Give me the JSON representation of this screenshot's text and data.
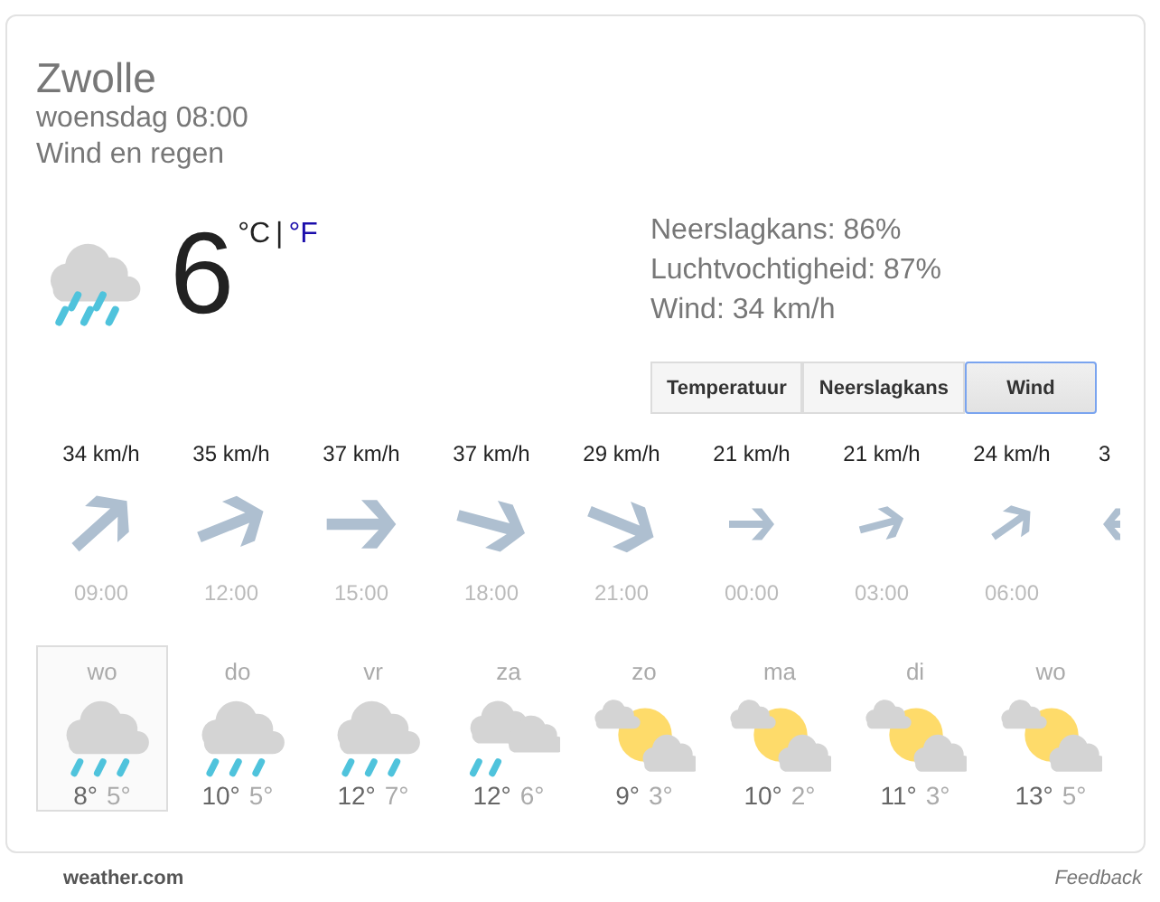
{
  "location": "Zwolle",
  "datetime": "woensdag 08:00",
  "condition": "Wind en regen",
  "current": {
    "kind": "rain",
    "temperature": "6",
    "unit_c": "°C",
    "unit_separator": "|",
    "unit_f": "°F",
    "unit_c_selected": true
  },
  "details": [
    "Neerslagkans: 86%",
    "Luchtvochtigheid: 87%",
    "Wind: 34 km/h"
  ],
  "tabs": [
    {
      "label": "Temperatuur",
      "selected": false
    },
    {
      "label": "Neerslagkans",
      "selected": false
    },
    {
      "label": "Wind",
      "selected": true
    }
  ],
  "hourly": [
    {
      "speed": "34 km/h",
      "kind": "northeast-large",
      "time": "09:00"
    },
    {
      "speed": "35 km/h",
      "kind": "eastnortheast-large",
      "time": "12:00"
    },
    {
      "speed": "37 km/h",
      "kind": "east-large",
      "time": "15:00"
    },
    {
      "speed": "37 km/h",
      "kind": "eastsoutheast-large",
      "time": "18:00"
    },
    {
      "speed": "29 km/h",
      "kind": "southeast-large",
      "time": "21:00"
    },
    {
      "speed": "21 km/h",
      "kind": "east-small",
      "time": "00:00"
    },
    {
      "speed": "21 km/h",
      "kind": "eastnortheast-small",
      "time": "03:00"
    },
    {
      "speed": "24 km/h",
      "kind": "northeast-small",
      "time": "06:00"
    },
    {
      "speed": "3",
      "kind": "west-small"
    }
  ],
  "daily": [
    {
      "day": "wo",
      "kind": "rain",
      "high": "8°",
      "low": "5°",
      "selected": true
    },
    {
      "day": "do",
      "kind": "rain",
      "high": "10°",
      "low": "5°",
      "selected": false
    },
    {
      "day": "vr",
      "kind": "rain",
      "high": "12°",
      "low": "7°",
      "selected": false
    },
    {
      "day": "za",
      "kind": "showers",
      "high": "12°",
      "low": "6°",
      "selected": false
    },
    {
      "day": "zo",
      "kind": "partly-sunny",
      "high": "9°",
      "low": "3°",
      "selected": false
    },
    {
      "day": "ma",
      "kind": "partly-sunny",
      "high": "10°",
      "low": "2°",
      "selected": false
    },
    {
      "day": "di",
      "kind": "partly-sunny",
      "high": "11°",
      "low": "3°",
      "selected": false
    },
    {
      "day": "wo",
      "kind": "partly-sunny",
      "high": "13°",
      "low": "5°",
      "selected": false
    }
  ],
  "footer": {
    "source": "weather.com",
    "feedback": "Feedback"
  }
}
